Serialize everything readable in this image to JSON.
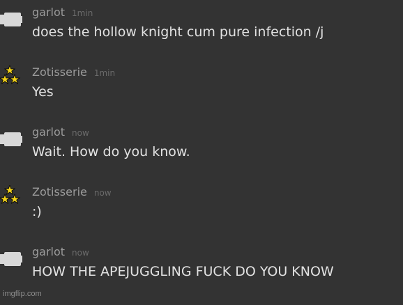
{
  "messages": [
    {
      "user": "garlot",
      "avatar_icon": "controller-icon",
      "time": "1min",
      "text": "does the hollow knight cum pure infection /j"
    },
    {
      "user": "Zotisserie",
      "avatar_icon": "stars-icon",
      "time": "1min",
      "text": "Yes"
    },
    {
      "user": "garlot",
      "avatar_icon": "controller-icon",
      "time": "now",
      "text": "Wait. How do you know."
    },
    {
      "user": "Zotisserie",
      "avatar_icon": "stars-icon",
      "time": "now",
      "text": ":)"
    },
    {
      "user": "garlot",
      "avatar_icon": "controller-icon",
      "time": "now",
      "text": "HOW THE APEJUGGLING FUCK DO YOU KNOW"
    }
  ],
  "watermark": "imgflip.com",
  "colors": {
    "background": "#333333",
    "username": "#9b9b9b",
    "timestamp": "#6b6b6b",
    "message_text": "#e2e2e2",
    "star": "#f2d21b"
  }
}
